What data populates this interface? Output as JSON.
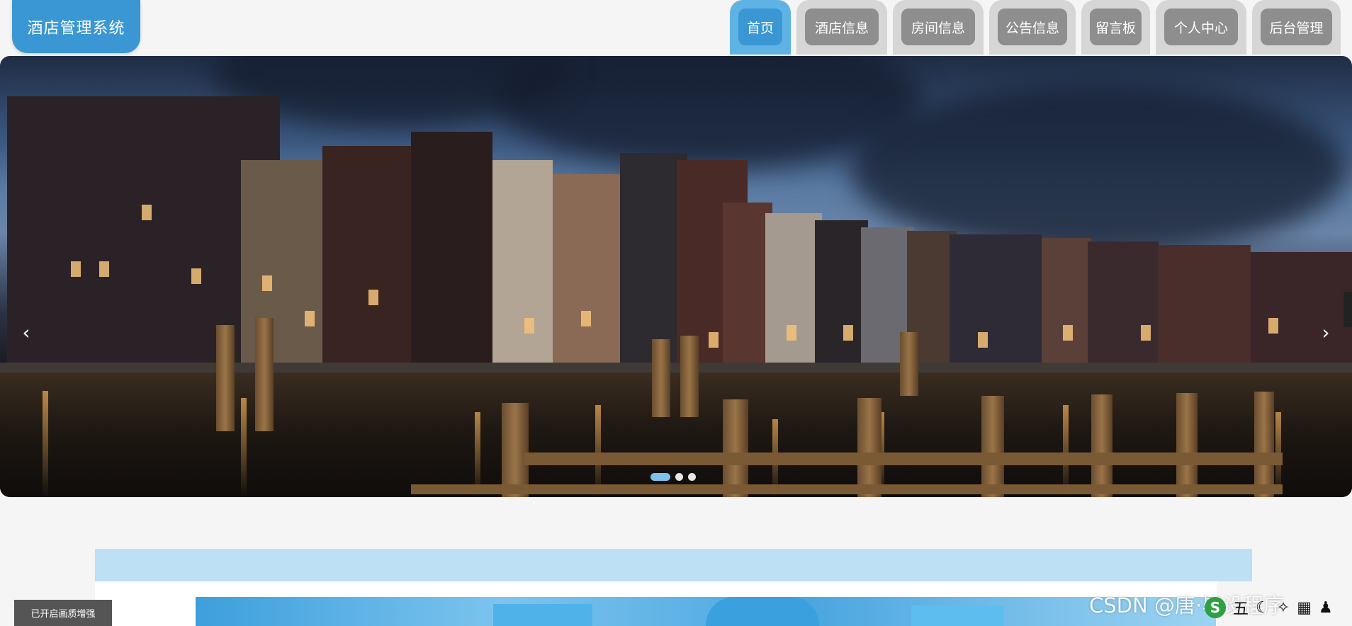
{
  "header": {
    "logo_text": "酒店管理系统",
    "nav": [
      {
        "label": "首页",
        "active": true
      },
      {
        "label": "酒店信息",
        "active": false
      },
      {
        "label": "房间信息",
        "active": false
      },
      {
        "label": "公告信息",
        "active": false
      },
      {
        "label": "留言板",
        "active": false
      },
      {
        "label": "个人中心",
        "active": false
      },
      {
        "label": "后台管理",
        "active": false
      }
    ]
  },
  "banner": {
    "prev_arrow": "‹",
    "next_arrow": "›",
    "slide_count": 3,
    "active_slide": 1
  },
  "status": {
    "enhance_label": "已开启画质增强"
  },
  "watermark": "CSDN @唐·毕设程序",
  "ime": {
    "logo": "S",
    "mode": "五"
  },
  "colors": {
    "accent": "#3a97d3",
    "nav_inactive": "#8e8e8e",
    "section_band": "#bde0f4"
  }
}
